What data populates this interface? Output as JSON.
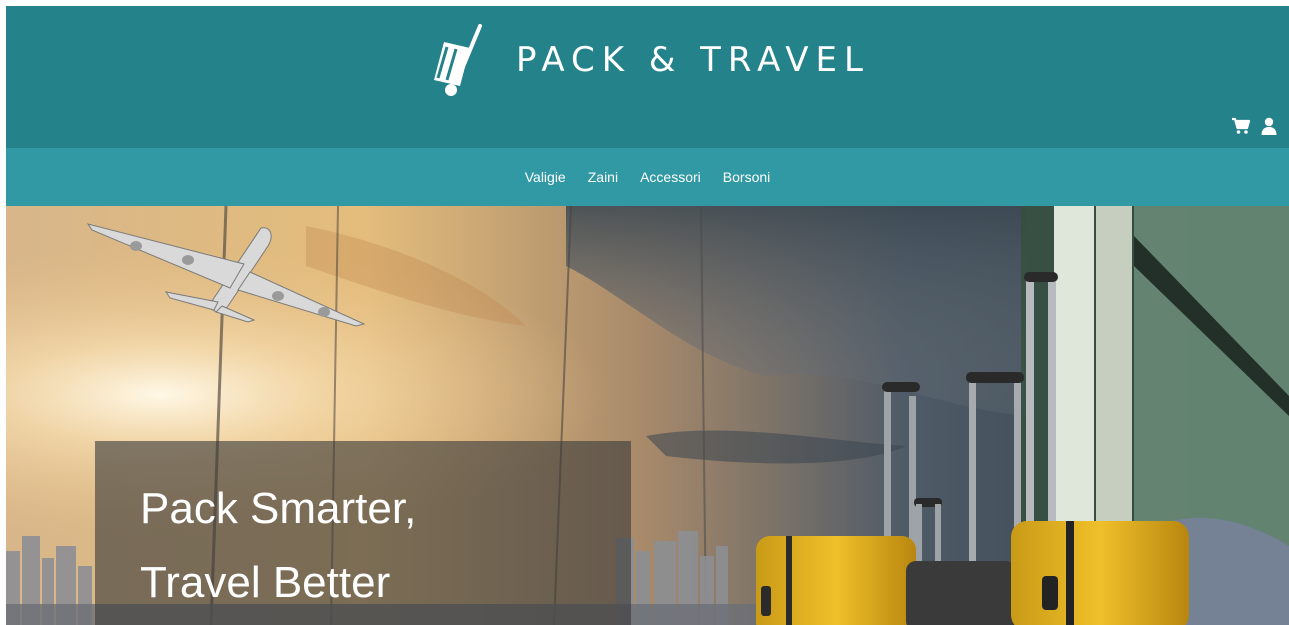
{
  "brand": {
    "name": "PACK & TRAVEL",
    "color": "#24828a",
    "nav_color": "#3099a4"
  },
  "header": {
    "icons": [
      "cart-icon",
      "user-icon"
    ]
  },
  "nav": {
    "items": [
      "Valigie",
      "Zaini",
      "Accessori",
      "Borsoni"
    ]
  },
  "hero": {
    "headline_line1": "Pack Smarter,",
    "headline_line2": "Travel Better"
  }
}
